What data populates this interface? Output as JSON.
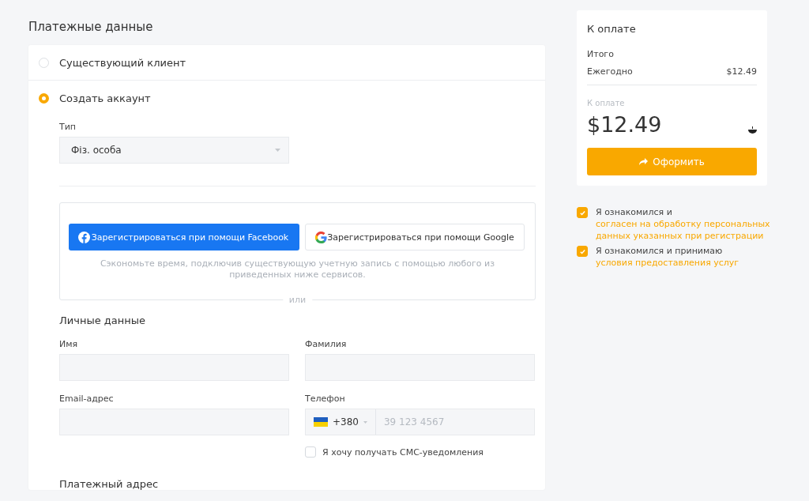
{
  "title": "Платежные данные",
  "client_options": [
    {
      "label": "Существующий клиент",
      "selected": false
    },
    {
      "label": "Создать аккаунт",
      "selected": true
    }
  ],
  "type_field": {
    "label": "Тип",
    "value": "Фіз. особа"
  },
  "social": {
    "buttons": [
      {
        "kind": "facebook",
        "label": "Зарегистрироваться при помощи Facebook"
      },
      {
        "kind": "google",
        "label": "Зарегистрироваться при помощи Google"
      }
    ],
    "hint": "Сэкономьте время, подключив существующую учетную запись с помощью любого из приведенных ниже сервисов.",
    "separator": "или"
  },
  "personal": {
    "heading": "Личные данные",
    "fields": [
      {
        "kind": "text",
        "label": "Имя"
      },
      {
        "kind": "text",
        "label": "Фамилия"
      },
      {
        "kind": "text",
        "label": "Email-адрес"
      },
      {
        "kind": "phone",
        "label": "Телефон",
        "code": "+380",
        "placeholder": "39 123 4567"
      }
    ],
    "sms": {
      "label": "Я хочу получать СМС-уведомления",
      "checked": false
    }
  },
  "billing_heading": "Платежный адрес",
  "summary": {
    "title": "К оплате",
    "subtotal_label": "Итого",
    "lines": [
      {
        "label": "Ежегодно",
        "amount": "$12.49"
      }
    ],
    "total_label": "К оплате",
    "total": "$12.49",
    "button": "Оформить"
  },
  "consents": [
    {
      "text": "Я ознакомился и",
      "link": "согласен на обработку персональных данных указанных при регистрации",
      "checked": true
    },
    {
      "text": "Я ознакомился и принимаю",
      "link": "условия предоставления услуг",
      "checked": true
    }
  ]
}
